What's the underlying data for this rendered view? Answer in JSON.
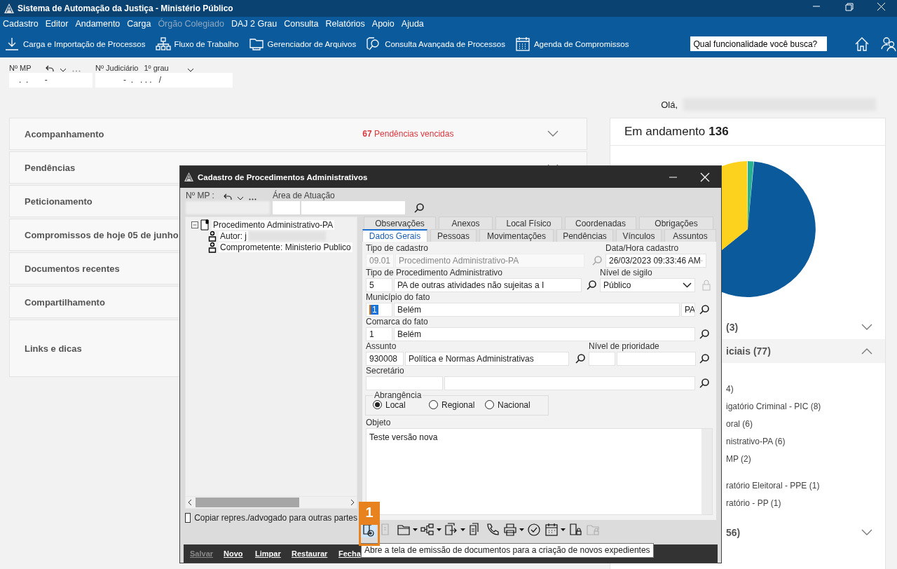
{
  "window": {
    "title": "Sistema de Automação da Justiça - Ministério Público"
  },
  "menu": [
    {
      "label": "Cadastro",
      "disabled": false
    },
    {
      "label": "Editor",
      "disabled": false
    },
    {
      "label": "Andamento",
      "disabled": false
    },
    {
      "label": "Carga",
      "disabled": false
    },
    {
      "label": "Órgão Colegiado",
      "disabled": true
    },
    {
      "label": "DAJ 2 Grau",
      "disabled": false
    },
    {
      "label": "Consulta",
      "disabled": false
    },
    {
      "label": "Relatórios",
      "disabled": false
    },
    {
      "label": "Apoio",
      "disabled": false
    },
    {
      "label": "Ajuda",
      "disabled": false
    }
  ],
  "toolbar": {
    "items": [
      {
        "kind": "download",
        "label": "Carga e Importação de Processos"
      },
      {
        "kind": "hierarchy",
        "label": "Fluxo de Trabalho"
      },
      {
        "kind": "folder",
        "label": "Gerenciador de Arquivos"
      },
      {
        "kind": "search-doc",
        "label": "Consulta Avançada de Processos"
      },
      {
        "kind": "calendar",
        "label": "Agenda de Compromissos"
      }
    ],
    "search": {
      "placeholder": "Qual funcionalidade você busca?"
    }
  },
  "process_number": {
    "mp_label": "Nº MP",
    "mp_value": ".  .       -",
    "judicial_label": "Nº Judiciário",
    "instance": "1º grau",
    "judicial_value": "-  .   . . .   /"
  },
  "greeting": "Olá,",
  "panels": [
    {
      "title": "Acompanhamento",
      "count": "67",
      "note": "Pendências vencidas",
      "expanded": false
    },
    {
      "title": "Pendências",
      "expanded": false
    },
    {
      "title": "Peticionamento"
    },
    {
      "title": "Compromissos de hoje 05 de junho"
    },
    {
      "title": "Documentos recentes"
    },
    {
      "title": "Compartilhamento"
    },
    {
      "title": "Links e dicas"
    }
  ],
  "summary": {
    "title": "Em andamento",
    "total": "136",
    "sections": [
      {
        "label": "(3)",
        "expanded": false
      },
      {
        "label": "iciais",
        "count": "(77)",
        "expanded": true,
        "items": [
          "4)",
          "igatório Criminal - PIC (8)",
          "oral (6)",
          "nistrativo-PA (6)",
          "MP (2)",
          "ratório Eleitoral - PPE (1)",
          "ratório - PP (1)"
        ]
      },
      {
        "label": "56)",
        "expanded": false
      }
    ]
  },
  "dialog": {
    "title": "Cadastro de Procedimentos Administrativos",
    "mp_label": "Nº MP :",
    "area_label": "Área de Atuação",
    "tree": [
      {
        "label": "Procedimento Administrativo-PA",
        "expanded": true,
        "children": [
          {
            "label": "Autor: j",
            "redacted": true
          },
          {
            "label": "Comprometente: Ministerio Publico",
            "redacted": false
          }
        ]
      }
    ],
    "copy_checkbox": {
      "label": "Copiar repres./advogado para outras partes",
      "checked": false
    },
    "tab_rows": [
      {
        "tabs": [
          {
            "label": "Observações",
            "selected": false
          },
          {
            "label": "Anexos",
            "selected": false
          },
          {
            "label": "Local Físico",
            "selected": false
          },
          {
            "label": "Coordenadas",
            "selected": false
          },
          {
            "label": "Obrigações",
            "selected": false
          }
        ]
      },
      {
        "tabs": [
          {
            "label": "Dados Gerais",
            "selected": true
          },
          {
            "label": "Pessoas",
            "selected": false
          },
          {
            "label": "Movimentações",
            "selected": false
          },
          {
            "label": "Pendências",
            "selected": false
          },
          {
            "label": "Vínculos",
            "selected": false
          },
          {
            "label": "Assuntos",
            "selected": false
          }
        ]
      }
    ],
    "rows": [
      [
        {
          "label": "Tipo de cadastro",
          "kind": "inputs",
          "disabled": true,
          "inputs": [
            {
              "value": "09.01"
            },
            {
              "value": "Procedimento Administrativo-PA"
            }
          ]
        },
        {
          "label": "Data/Hora cadastro",
          "kind": "select",
          "value": "26/03/2023 09:33:46 AM"
        }
      ],
      [
        {
          "label": "Tipo de Procedimento Administrativo",
          "kind": "inputs",
          "disabled": false,
          "inputs": [
            {
              "value": "5"
            },
            {
              "value": "PA de outras atividades não sujeitas a I"
            }
          ]
        },
        {
          "label": "Nível de sigilo",
          "kind": "select",
          "value": "Público"
        }
      ],
      [
        {
          "label": "Município do fato",
          "kind": "inputs",
          "disabled": false,
          "inputs": [
            {
              "value": "1",
              "highlighted": true
            },
            {
              "value": "Belém"
            },
            {
              "value": "PA"
            }
          ]
        }
      ],
      [
        {
          "label": "Comarca do fato",
          "kind": "inputs",
          "disabled": false,
          "inputs": [
            {
              "value": "1"
            },
            {
              "value": "Belém"
            }
          ]
        }
      ],
      [
        {
          "label": "Assunto",
          "kind": "inputs",
          "disabled": false,
          "inputs": [
            {
              "value": "930008"
            },
            {
              "value": "Política e Normas Administrativas"
            }
          ]
        },
        {
          "label": "Nível de prioridade",
          "kind": "inputs"
        }
      ],
      [
        {
          "label": "Secretário",
          "kind": "inputs"
        }
      ]
    ],
    "scope": {
      "legend": "Abrangência",
      "options": [
        {
          "label": "Local",
          "selected": true
        },
        {
          "label": "Regional",
          "selected": false
        },
        {
          "label": "Nacional",
          "selected": false
        }
      ]
    },
    "object": {
      "label": "Objeto",
      "value": "Teste versão nova"
    },
    "tools": [
      {
        "kind": "new-document",
        "caret": false,
        "disabled": false,
        "highlighted": true
      },
      {
        "kind": "doc-p",
        "caret": false,
        "disabled": true,
        "highlighted": false
      },
      {
        "kind": "folder",
        "caret": true,
        "disabled": false,
        "highlighted": false
      },
      {
        "kind": "tree",
        "caret": true,
        "disabled": false,
        "highlighted": false
      },
      {
        "kind": "doc-arrow",
        "caret": true,
        "disabled": false,
        "highlighted": false
      },
      {
        "kind": "clipboard",
        "caret": false,
        "disabled": false,
        "highlighted": false
      },
      {
        "kind": "phone",
        "caret": false,
        "disabled": false,
        "highlighted": false
      },
      {
        "kind": "printer",
        "caret": true,
        "disabled": false,
        "highlighted": false
      },
      {
        "kind": "check",
        "caret": false,
        "disabled": false,
        "highlighted": false
      },
      {
        "kind": "calendar",
        "caret": true,
        "disabled": false,
        "highlighted": false
      },
      {
        "kind": "doc-lock",
        "caret": false,
        "disabled": false,
        "highlighted": false
      },
      {
        "kind": "folder-lock",
        "caret": false,
        "disabled": true,
        "highlighted": false
      }
    ],
    "buttons": [
      {
        "label": "Salvar",
        "disabled": true
      },
      {
        "label": "Novo",
        "disabled": false
      },
      {
        "label": "Limpar",
        "disabled": false
      },
      {
        "label": "Restaurar",
        "disabled": false
      },
      {
        "label": "Fecha",
        "disabled": false
      }
    ],
    "tooltip": "Abre a tela de emissão de documentos para a criação de novos expedientes",
    "callout": "1"
  }
}
